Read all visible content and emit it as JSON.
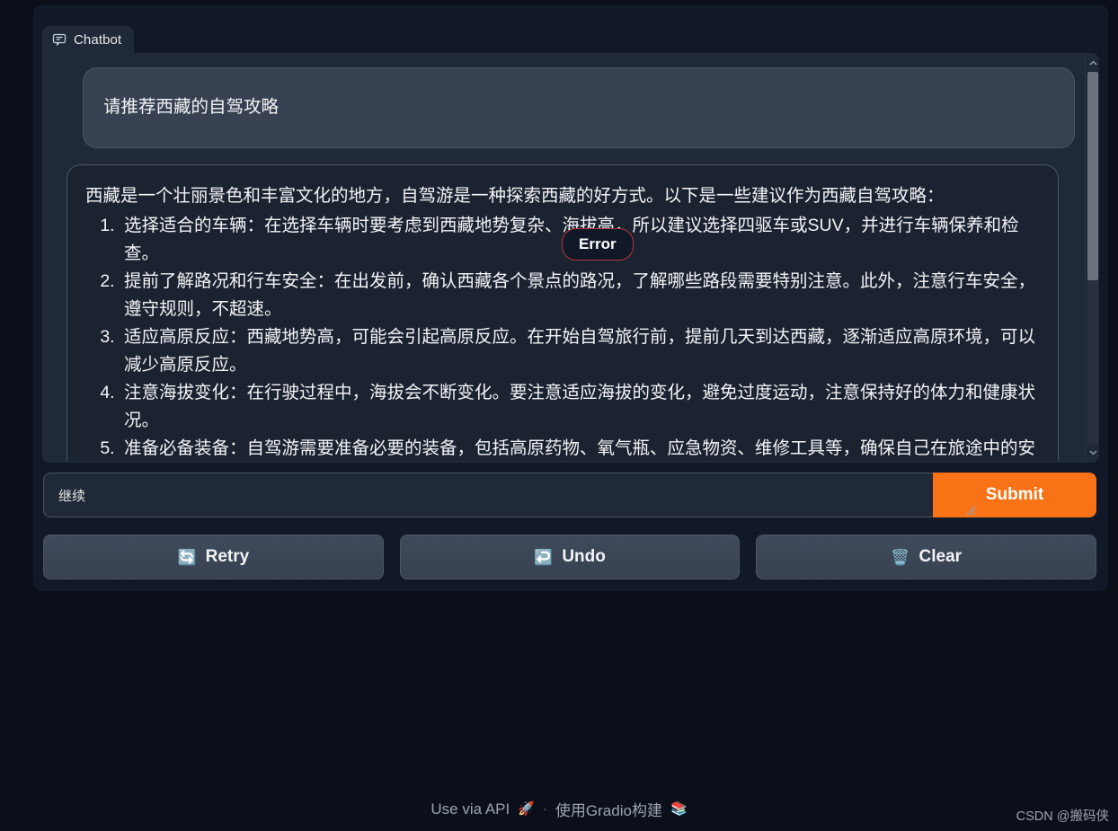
{
  "app": {
    "background_color": "#0b0f19",
    "panel_color": "#1f2937",
    "accent_color": "#f97316"
  },
  "chatbot": {
    "tab_label": "Chatbot",
    "tab_icon": "chat-bubble-icon"
  },
  "conversation": {
    "user_message": "请推荐西藏的自驾攻略",
    "bot_intro": "西藏是一个壮丽景色和丰富文化的地方，自驾游是一种探索西藏的好方式。以下是一些建议作为西藏自驾攻略：",
    "bot_items": [
      "选择适合的车辆：在选择车辆时要考虑到西藏地势复杂、海拔高，所以建议选择四驱车或SUV，并进行车辆保养和检查。",
      "提前了解路况和行车安全：在出发前，确认西藏各个景点的路况，了解哪些路段需要特别注意。此外，注意行车安全，遵守规则，不超速。",
      "适应高原反应：西藏地势高，可能会引起高原反应。在开始自驾旅行前，提前几天到达西藏，逐渐适应高原环境，可以减少高原反应。",
      "注意海拔变化：在行驶过程中，海拔会不断变化。要注意适应海拔的变化，避免过度运动，注意保持好的体力和健康状况。",
      "准备必备装备：自驾游需要准备必要的装备，包括高原药物、氧气瓶、应急物资、维修工具等，确保自己在旅途中的安"
    ]
  },
  "error_badge": {
    "label": "Error",
    "border_color": "#b4363a"
  },
  "input": {
    "value": "继续",
    "placeholder": "",
    "submit_label": "Submit"
  },
  "actions": [
    {
      "label": "Retry",
      "icon": "refresh-icon",
      "emoji": "🔄"
    },
    {
      "label": "Undo",
      "icon": "undo-arrow-icon",
      "emoji": "↩️"
    },
    {
      "label": "Clear",
      "icon": "trash-icon",
      "emoji": "🗑️"
    }
  ],
  "footer": {
    "api_link": "Use via API",
    "api_emoji": "🚀",
    "separator": "·",
    "built_with": "使用Gradio构建",
    "gradio_emoji": "📚"
  },
  "watermark": "CSDN @搬码侠"
}
